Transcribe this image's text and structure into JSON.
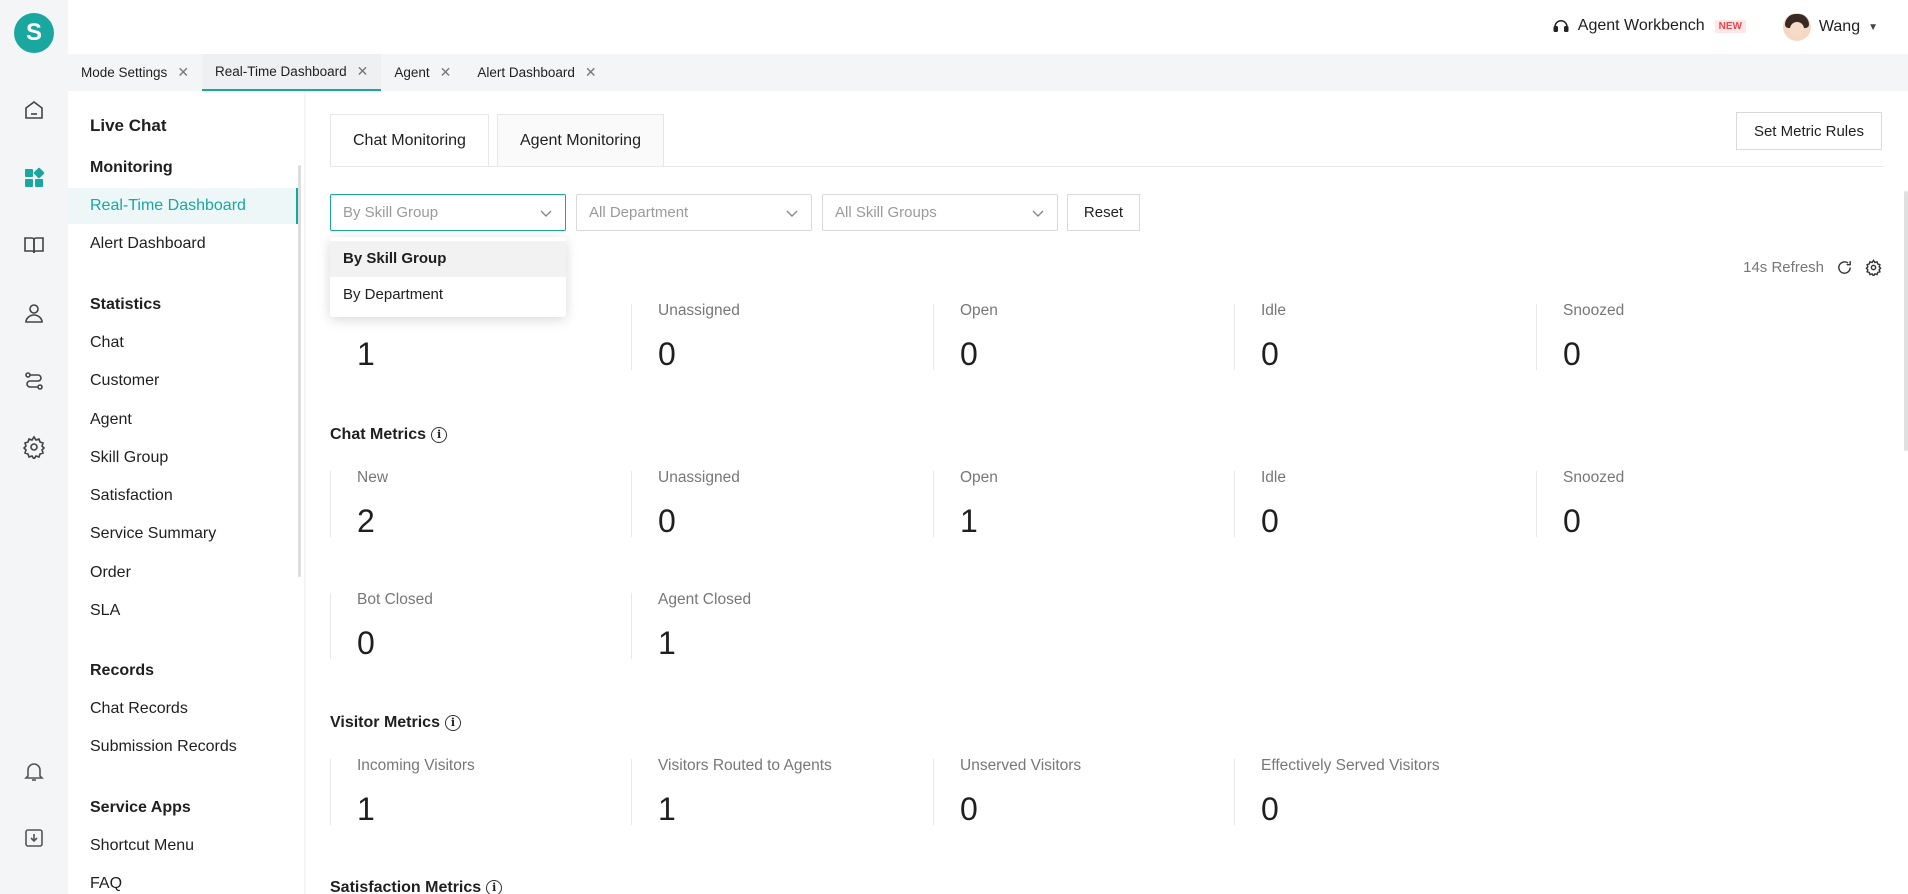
{
  "app": {
    "logo_letter": "S"
  },
  "rail": {
    "icons": [
      "home-icon",
      "dashboard-icon",
      "book-icon",
      "agent-icon",
      "routing-icon",
      "settings-icon",
      "bell-icon",
      "download-icon"
    ]
  },
  "topbar": {
    "workbench_label": "Agent Workbench",
    "new_badge": "NEW",
    "user_name": "Wang"
  },
  "tabs": [
    {
      "label": "Mode Settings",
      "close": "✕"
    },
    {
      "label": "Real-Time Dashboard",
      "close": "✕"
    },
    {
      "label": "Agent",
      "close": "✕"
    },
    {
      "label": "Alert Dashboard",
      "close": "✕"
    }
  ],
  "nav": {
    "title": "Live Chat",
    "sections": [
      {
        "title": "Monitoring",
        "items": [
          "Real-Time Dashboard",
          "Alert Dashboard"
        ]
      },
      {
        "title": "Statistics",
        "items": [
          "Chat",
          "Customer",
          "Agent",
          "Skill Group",
          "Satisfaction",
          "Service Summary",
          "Order",
          "SLA"
        ]
      },
      {
        "title": "Records",
        "items": [
          "Chat Records",
          "Submission Records"
        ]
      },
      {
        "title": "Service Apps",
        "items": [
          "Shortcut Menu",
          "FAQ"
        ]
      }
    ]
  },
  "main": {
    "tabs": [
      "Chat Monitoring",
      "Agent Monitoring"
    ],
    "set_rules_label": "Set Metric Rules",
    "filters": {
      "group_by_placeholder": "By Skill Group",
      "department_placeholder": "All Department",
      "skill_groups_placeholder": "All Skill Groups",
      "reset_label": "Reset"
    },
    "dropdown_options": [
      "By Skill Group",
      "By Department"
    ],
    "refresh_label": "14s Refresh",
    "top_metrics": [
      {
        "label": "",
        "value": "1"
      },
      {
        "label": "Unassigned",
        "value": "0"
      },
      {
        "label": "Open",
        "value": "0"
      },
      {
        "label": "Idle",
        "value": "0"
      },
      {
        "label": "Snoozed",
        "value": "0"
      }
    ],
    "chat_metrics_title": "Chat Metrics",
    "chat_metrics": [
      {
        "label": "New",
        "value": "2"
      },
      {
        "label": "Unassigned",
        "value": "0"
      },
      {
        "label": "Open",
        "value": "1"
      },
      {
        "label": "Idle",
        "value": "0"
      },
      {
        "label": "Snoozed",
        "value": "0"
      },
      {
        "label": "Bot Closed",
        "value": "0"
      },
      {
        "label": "Agent Closed",
        "value": "1"
      }
    ],
    "visitor_metrics_title": "Visitor Metrics",
    "visitor_metrics": [
      {
        "label": "Incoming Visitors",
        "value": "1"
      },
      {
        "label": "Visitors Routed to Agents",
        "value": "1"
      },
      {
        "label": "Unserved Visitors",
        "value": "0"
      },
      {
        "label": "Effectively Served Visitors",
        "value": "0"
      }
    ],
    "satisfaction_metrics_title": "Satisfaction Metrics",
    "info_glyph": "i"
  },
  "colors": {
    "accent": "#1aa7a0",
    "new_badge": "#e5484d"
  }
}
